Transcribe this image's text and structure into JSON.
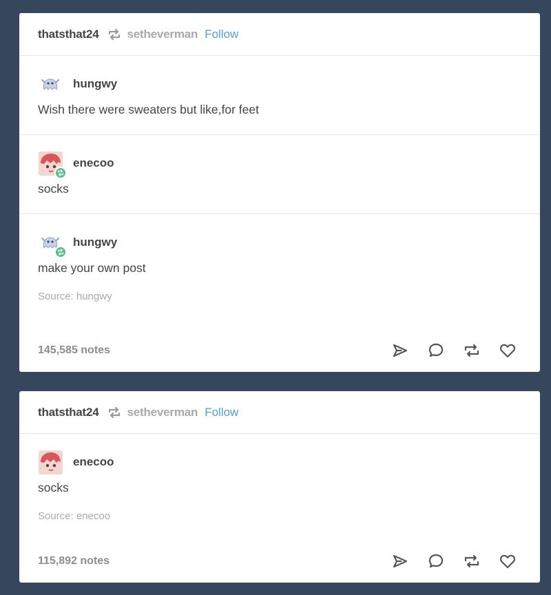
{
  "colors": {
    "background": "#36465d",
    "card": "#ffffff",
    "follow_link": "#529ecc",
    "reblog_badge": "#56bc8a"
  },
  "posts": [
    {
      "header": {
        "user": "thatsthat24",
        "reblog_icon": "reblog-icon",
        "source_user": "setheverman",
        "follow_label": "Follow"
      },
      "entries": [
        {
          "user": "hungwy",
          "avatar": "ghost-avatar",
          "reblog_badge": false,
          "text": "Wish there were sweaters but like,for feet"
        },
        {
          "user": "enecoo",
          "avatar": "red-character-avatar",
          "reblog_badge": true,
          "text": "socks"
        },
        {
          "user": "hungwy",
          "avatar": "ghost-avatar",
          "reblog_badge": true,
          "text": "make your own post"
        }
      ],
      "source": "Source:  hungwy",
      "notes": "145,585 notes",
      "actions": [
        "share-icon",
        "reply-icon",
        "reblog-icon",
        "like-icon"
      ]
    },
    {
      "header": {
        "user": "thatsthat24",
        "reblog_icon": "reblog-icon",
        "source_user": "setheverman",
        "follow_label": "Follow"
      },
      "entries": [
        {
          "user": "enecoo",
          "avatar": "red-character-avatar",
          "reblog_badge": false,
          "text": "socks"
        }
      ],
      "source": "Source:  enecoo",
      "notes": "115,892 notes",
      "actions": [
        "share-icon",
        "reply-icon",
        "reblog-icon",
        "like-icon"
      ]
    }
  ]
}
